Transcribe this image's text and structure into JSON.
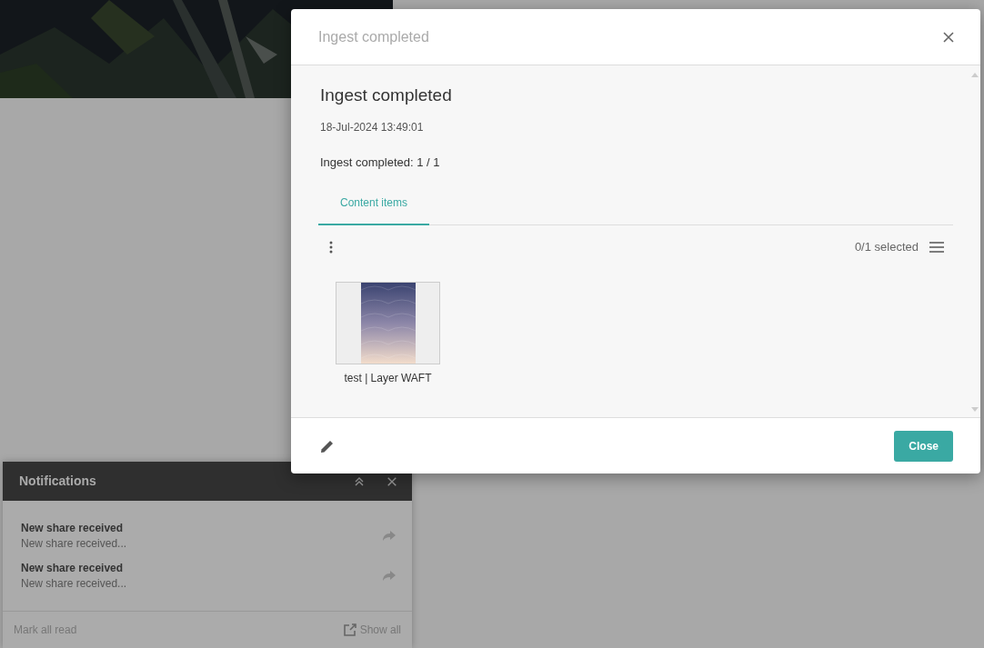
{
  "modal": {
    "title": "Ingest completed",
    "heading": "Ingest completed",
    "timestamp": "18-Jul-2024 13:49:01",
    "summary": "Ingest completed: 1 / 1",
    "tabs": [
      {
        "label": "Content items",
        "selected": true
      }
    ],
    "selection_count": "0/1 selected",
    "items": [
      {
        "caption": "test | Layer WAFT",
        "kind": "picture"
      }
    ],
    "buttons": [
      {
        "label": "Close"
      }
    ]
  },
  "notifications": {
    "title": "Notifications",
    "items": [
      {
        "title": "New share received",
        "body": "New share received..."
      },
      {
        "title": "New share received",
        "body": "New share received..."
      }
    ],
    "mark_all": "Mark all read",
    "show_all": "Show all"
  }
}
